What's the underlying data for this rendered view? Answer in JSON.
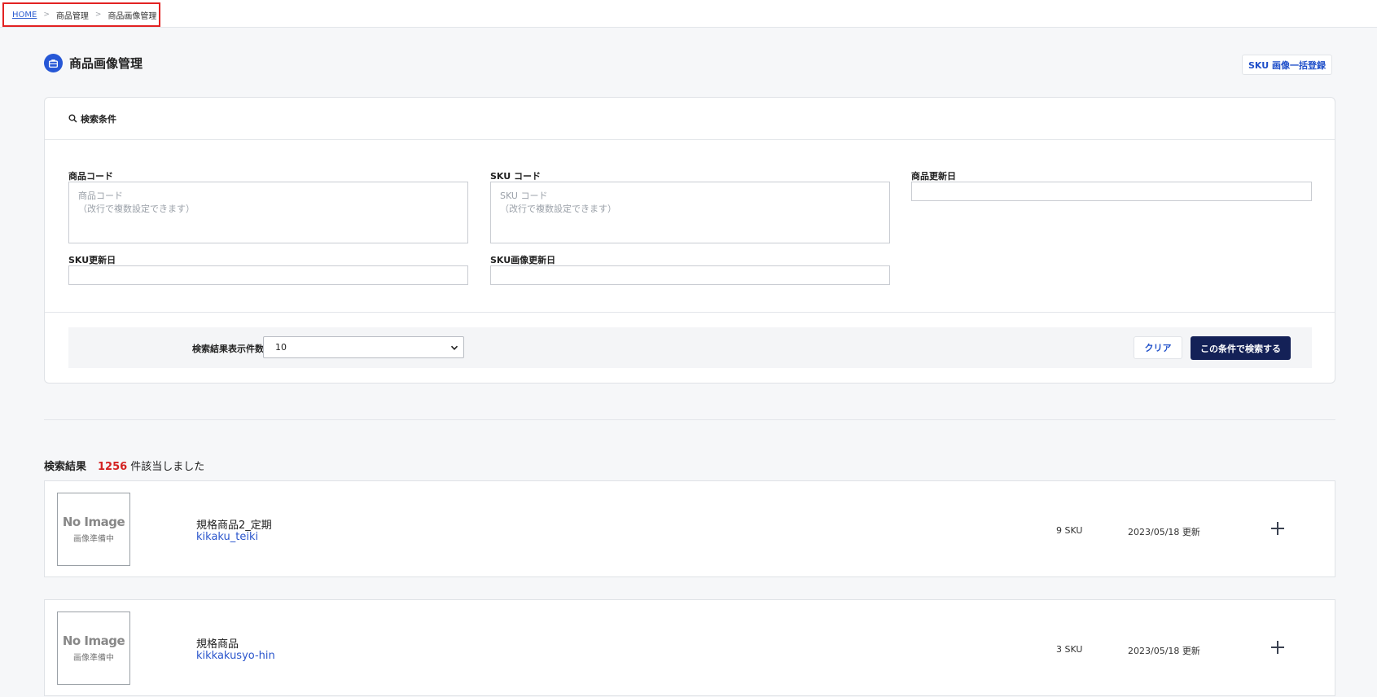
{
  "breadcrumb": {
    "home": "HOME",
    "sep": ">",
    "level1": "商品管理",
    "level2": "商品画像管理"
  },
  "page": {
    "title": "商品画像管理",
    "bulk_button": "SKU 画像一括登録"
  },
  "search": {
    "header": "検索条件",
    "product_code": {
      "label": "商品コード",
      "placeholder": "商品コード\n（改行で複数設定できます）"
    },
    "sku_code": {
      "label": "SKU コード",
      "placeholder": "SKU コード\n（改行で複数設定できます）"
    },
    "product_updated": {
      "label": "商品更新日"
    },
    "sku_updated": {
      "label": "SKU更新日"
    },
    "sku_image_updated": {
      "label": "SKU画像更新日"
    },
    "display_count_label": "検索結果表示件数",
    "display_count_value": "10",
    "clear_button": "クリア",
    "search_button": "この条件で検索する"
  },
  "results": {
    "title": "検索結果",
    "count": "1256",
    "count_suffix": "件該当しました",
    "items": [
      {
        "image_title": "No Image",
        "image_sub": "画像準備中",
        "name": "規格商品2_定期",
        "code": "kikaku_teiki",
        "sku": "9 SKU",
        "updated": "2023/05/18 更新"
      },
      {
        "image_title": "No Image",
        "image_sub": "画像準備中",
        "name": "規格商品",
        "code": "kikkakusyo-hin",
        "sku": "3 SKU",
        "updated": "2023/05/18 更新"
      }
    ]
  },
  "colors": {
    "accent": "#2657d6",
    "primary_button": "#142157",
    "count_red": "#d42222",
    "highlight_border": "#e22222"
  }
}
